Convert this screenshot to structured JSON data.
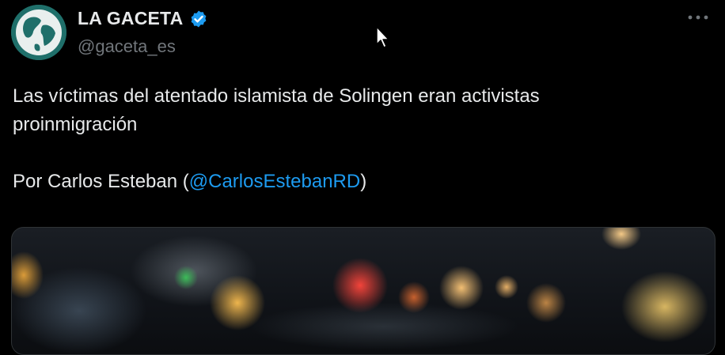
{
  "account": {
    "display_name": "LA GACETA",
    "handle": "@gaceta_es",
    "verified": true,
    "accent": "#1d9bf0"
  },
  "tweet": {
    "line1": "Las víctimas del atentado islamista de Solingen eran activistas",
    "line2": "proinmigración",
    "byline_prefix": "Por Carlos Esteban (",
    "mention": "@CarlosEstebanRD",
    "byline_suffix": ")"
  },
  "icons": {
    "more": "more-icon",
    "verified": "verified-badge-icon",
    "avatar": "globe-logo-icon",
    "cursor": "mouse-pointer-icon"
  }
}
